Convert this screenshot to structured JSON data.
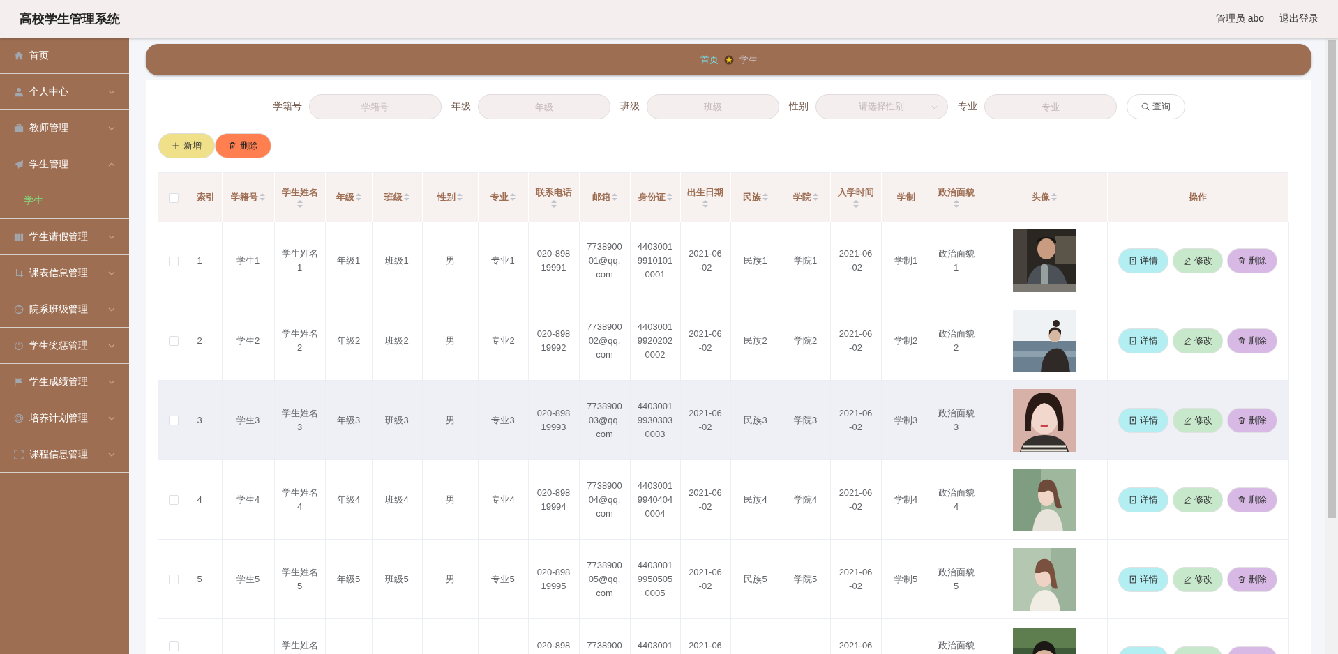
{
  "header": {
    "title": "高校学生管理系统",
    "user": "管理员 abo",
    "logout": "退出登录"
  },
  "sidebar": {
    "items": [
      {
        "label": "首页"
      },
      {
        "label": "个人中心",
        "expanded": false
      },
      {
        "label": "教师管理",
        "expanded": false
      },
      {
        "label": "学生管理",
        "expanded": true,
        "children": [
          {
            "label": "学生",
            "selected": true
          }
        ]
      },
      {
        "label": "学生请假管理",
        "expanded": false
      },
      {
        "label": "课表信息管理",
        "expanded": false
      },
      {
        "label": "院系班级管理",
        "expanded": false
      },
      {
        "label": "学生奖惩管理",
        "expanded": false
      },
      {
        "label": "学生成绩管理",
        "expanded": false
      },
      {
        "label": "培养计划管理",
        "expanded": false
      },
      {
        "label": "课程信息管理",
        "expanded": false
      }
    ]
  },
  "breadcrumb": [
    {
      "label": "首页",
      "current": false
    },
    {
      "label": "学生",
      "current": true
    }
  ],
  "search": {
    "fields": [
      {
        "label": "学籍号",
        "placeholder": "学籍号",
        "kind": "text"
      },
      {
        "label": "年级",
        "placeholder": "年级",
        "kind": "text"
      },
      {
        "label": "班级",
        "placeholder": "班级",
        "kind": "text"
      },
      {
        "label": "性别",
        "placeholder": "请选择性别",
        "kind": "select"
      },
      {
        "label": "专业",
        "placeholder": "专业",
        "kind": "text"
      }
    ],
    "button": "查询"
  },
  "toolbar": [
    {
      "label": "新增",
      "kind": "add"
    },
    {
      "label": "删除",
      "kind": "delete"
    }
  ],
  "table": {
    "select_all_checked": false,
    "columns": [
      {
        "kind": "check"
      },
      {
        "label": "索引",
        "kind": "text",
        "sortable": false
      },
      {
        "label": "学籍号",
        "kind": "text",
        "sortable": true
      },
      {
        "label": "学生姓名",
        "kind": "text",
        "sortable": true
      },
      {
        "label": "年级",
        "kind": "text",
        "sortable": true
      },
      {
        "label": "班级",
        "kind": "text",
        "sortable": true
      },
      {
        "label": "性别",
        "kind": "text",
        "sortable": true
      },
      {
        "label": "专业",
        "kind": "text",
        "sortable": true
      },
      {
        "label": "联系电话",
        "kind": "text",
        "sortable": true
      },
      {
        "label": "邮箱",
        "kind": "text",
        "sortable": true
      },
      {
        "label": "身份证",
        "kind": "text",
        "sortable": true
      },
      {
        "label": "出生日期",
        "kind": "text",
        "sortable": true
      },
      {
        "label": "民族",
        "kind": "text",
        "sortable": true
      },
      {
        "label": "学院",
        "kind": "text",
        "sortable": true
      },
      {
        "label": "入学时间",
        "kind": "text",
        "sortable": true
      },
      {
        "label": "学制",
        "kind": "text",
        "sortable": false
      },
      {
        "label": "政治面貌",
        "kind": "text",
        "sortable": true
      },
      {
        "label": "头像",
        "kind": "picture",
        "sortable": true
      },
      {
        "label": "操作",
        "kind": "actions",
        "sortable": false
      }
    ],
    "rows": [
      {
        "checked": false,
        "highlighted": false,
        "cells": [
          "",
          "1",
          "学生1",
          "学生姓名1",
          "年级1",
          "班级1",
          "男",
          "专业1",
          "020-89819991",
          "773890001@qq.com",
          "440300199101010001",
          "2021-06-02",
          "民族1",
          "学院1",
          "2021-06-02",
          "学制1",
          "政治面貌1",
          {
            "kind": "picture"
          },
          ""
        ],
        "actions": [
          {
            "label": "详情",
            "kind": "detail"
          },
          {
            "label": "修改",
            "kind": "edit"
          },
          {
            "label": "删除",
            "kind": "delete"
          }
        ]
      },
      {
        "checked": false,
        "highlighted": false,
        "cells": [
          "",
          "2",
          "学生2",
          "学生姓名2",
          "年级2",
          "班级2",
          "男",
          "专业2",
          "020-89819992",
          "773890002@qq.com",
          "440300199202020002",
          "2021-06-02",
          "民族2",
          "学院2",
          "2021-06-02",
          "学制2",
          "政治面貌2",
          {
            "kind": "picture"
          },
          ""
        ],
        "actions": [
          {
            "label": "详情",
            "kind": "detail"
          },
          {
            "label": "修改",
            "kind": "edit"
          },
          {
            "label": "删除",
            "kind": "delete"
          }
        ]
      },
      {
        "checked": false,
        "highlighted": true,
        "cells": [
          "",
          "3",
          "学生3",
          "学生姓名3",
          "年级3",
          "班级3",
          "男",
          "专业3",
          "020-89819993",
          "773890003@qq.com",
          "440300199303030003",
          "2021-06-02",
          "民族3",
          "学院3",
          "2021-06-02",
          "学制3",
          "政治面貌3",
          {
            "kind": "picture"
          },
          ""
        ],
        "actions": [
          {
            "label": "详情",
            "kind": "detail"
          },
          {
            "label": "修改",
            "kind": "edit"
          },
          {
            "label": "删除",
            "kind": "delete"
          }
        ]
      },
      {
        "checked": false,
        "highlighted": false,
        "cells": [
          "",
          "4",
          "学生4",
          "学生姓名4",
          "年级4",
          "班级4",
          "男",
          "专业4",
          "020-89819994",
          "773890004@qq.com",
          "440300199404040004",
          "2021-06-02",
          "民族4",
          "学院4",
          "2021-06-02",
          "学制4",
          "政治面貌4",
          {
            "kind": "picture"
          },
          ""
        ],
        "actions": [
          {
            "label": "详情",
            "kind": "detail"
          },
          {
            "label": "修改",
            "kind": "edit"
          },
          {
            "label": "删除",
            "kind": "delete"
          }
        ]
      },
      {
        "checked": false,
        "highlighted": false,
        "cells": [
          "",
          "5",
          "学生5",
          "学生姓名5",
          "年级5",
          "班级5",
          "男",
          "专业5",
          "020-89819995",
          "773890005@qq.com",
          "440300199505050005",
          "2021-06-02",
          "民族5",
          "学院5",
          "2021-06-02",
          "学制5",
          "政治面貌5",
          {
            "kind": "picture"
          },
          ""
        ],
        "actions": [
          {
            "label": "详情",
            "kind": "detail"
          },
          {
            "label": "修改",
            "kind": "edit"
          },
          {
            "label": "删除",
            "kind": "delete"
          }
        ]
      },
      {
        "checked": false,
        "highlighted": false,
        "cells": [
          "",
          "",
          "",
          "学生姓名",
          "",
          "",
          "",
          "",
          "020-898",
          "7738900",
          "4403001",
          "2021-06",
          "",
          "",
          "2021-06",
          "",
          "政治面貌",
          {
            "kind": "picture"
          },
          ""
        ],
        "actions": [
          {
            "kind": "detail"
          },
          {
            "kind": "edit"
          },
          {
            "kind": "delete"
          }
        ]
      }
    ]
  }
}
